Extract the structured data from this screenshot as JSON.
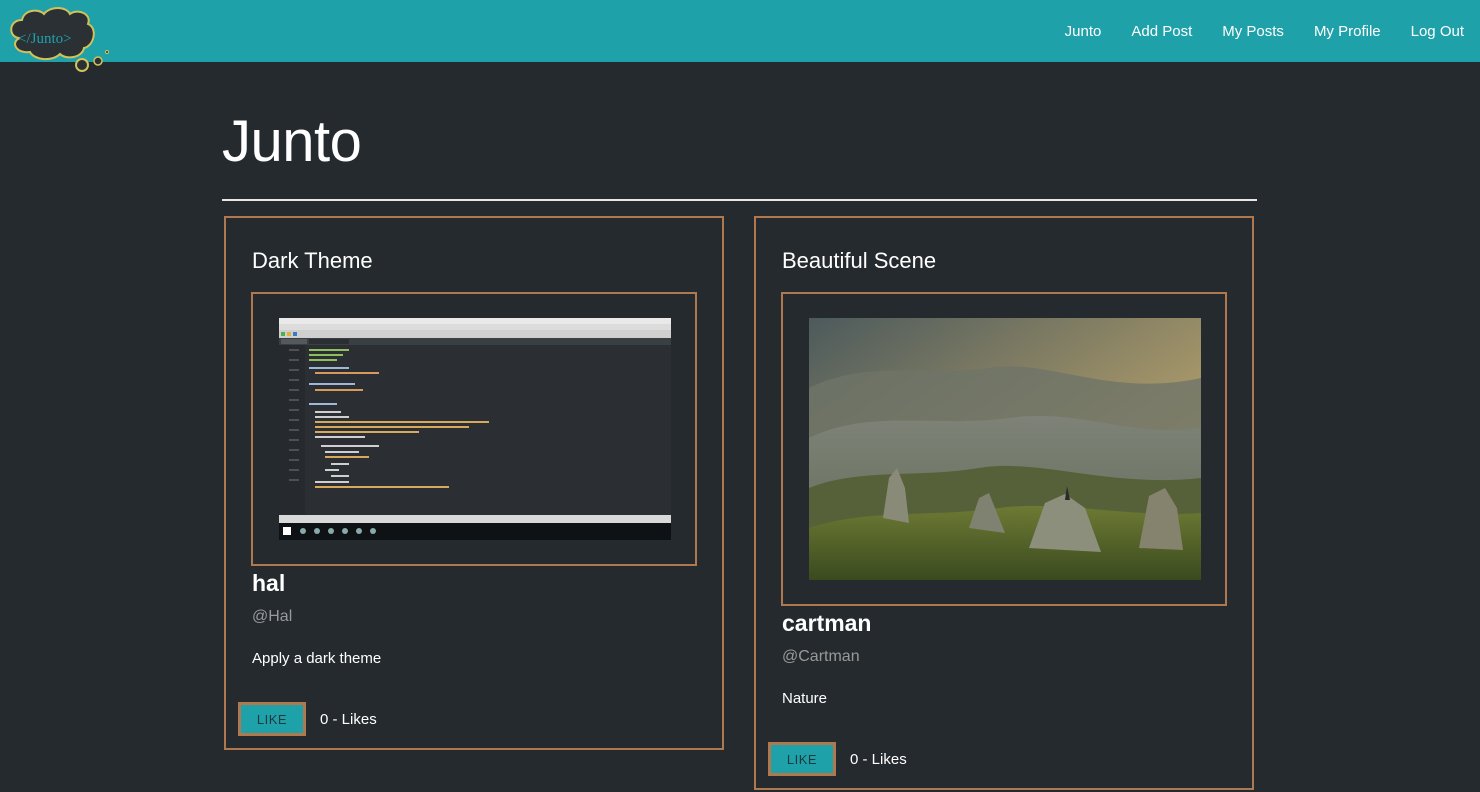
{
  "nav": {
    "logo_text": "</Junto>",
    "links": [
      "Junto",
      "Add Post",
      "My Posts",
      "My Profile",
      "Log Out"
    ]
  },
  "page": {
    "title": "Junto"
  },
  "posts": [
    {
      "title": "Dark Theme",
      "image": "code-editor-screenshot",
      "author": "hal",
      "handle": "@Hal",
      "caption": "Apply a dark theme",
      "like_label": "LIKE",
      "likes_text": "0 - Likes"
    },
    {
      "title": "Beautiful Scene",
      "image": "mountain-landscape-photo",
      "author": "cartman",
      "handle": "@Cartman",
      "caption": "Nature",
      "like_label": "LIKE",
      "likes_text": "0 - Likes"
    }
  ],
  "colors": {
    "navbar": "#1fa1aa",
    "background": "#242a2e",
    "border": "#b0784e",
    "handle": "#999999"
  }
}
